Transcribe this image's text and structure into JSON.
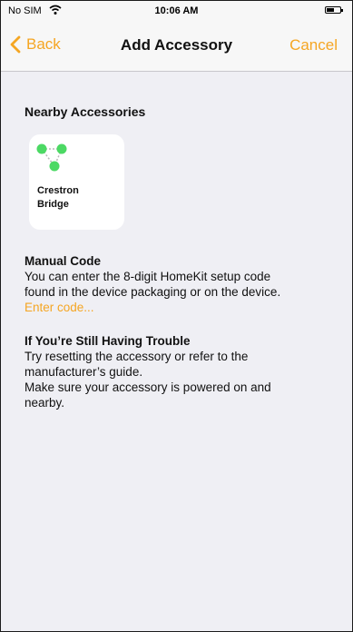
{
  "status_bar": {
    "carrier": "No SIM",
    "time": "10:06 AM"
  },
  "nav": {
    "back_label": "Back",
    "title": "Add Accessory",
    "cancel_label": "Cancel"
  },
  "nearby": {
    "title": "Nearby Accessories",
    "accessories": [
      {
        "name_line1": "Crestron",
        "name_line2": "Bridge",
        "icon": "crestron-bridge-icon"
      }
    ]
  },
  "manual_code": {
    "title": "Manual Code",
    "line1": "You can enter the 8-digit HomeKit setup code",
    "line2": "found in the device packaging or on the device.",
    "link": "Enter code..."
  },
  "trouble": {
    "title": "If You’re Still Having Trouble",
    "line1": "Try resetting the accessory or refer to the",
    "line2": "manufacturer’s guide.",
    "line3": "Make sure your accessory is powered on and",
    "line4": "nearby."
  },
  "colors": {
    "accent": "#f5a623",
    "icon_green": "#4cd964",
    "background": "#efeff4"
  }
}
